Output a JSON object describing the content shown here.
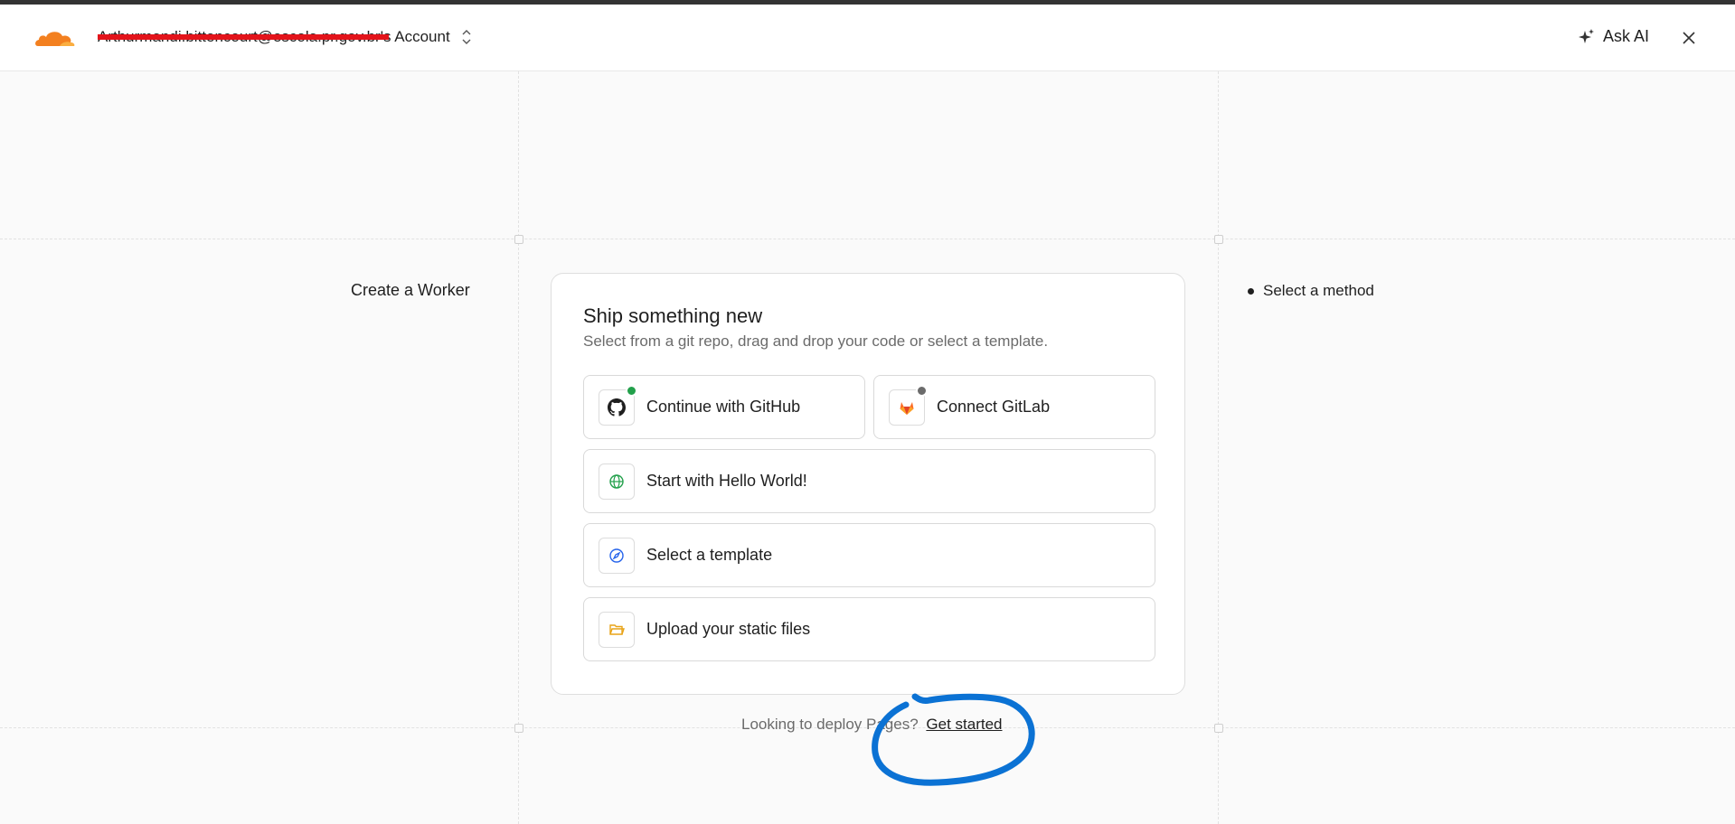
{
  "header": {
    "account_name": "Arthurmandi.bittencourt@escola.pr.gov.br's Account",
    "ask_ai_label": "Ask AI"
  },
  "page": {
    "left_title": "Create a Worker",
    "steps": [
      "Select a method"
    ]
  },
  "card": {
    "title": "Ship something new",
    "subtitle": "Select from a git repo, drag and drop your code or select a template.",
    "options": {
      "github": {
        "label": "Continue with GitHub",
        "icon": "github-icon",
        "status_color": "#22a04b"
      },
      "gitlab": {
        "label": "Connect GitLab",
        "icon": "gitlab-icon",
        "status_color": "#6b6b6b"
      },
      "hello_world": {
        "label": "Start with Hello World!",
        "icon": "globe-icon"
      },
      "template": {
        "label": "Select a template",
        "icon": "compass-icon"
      },
      "upload": {
        "label": "Upload your static files",
        "icon": "folder-icon"
      }
    }
  },
  "footer": {
    "prompt": "Looking to deploy Pages?",
    "link": "Get started"
  },
  "colors": {
    "brand_orange": "#f38020",
    "annotation_blue": "#0b72d4",
    "redaction_red": "#e3141b"
  }
}
